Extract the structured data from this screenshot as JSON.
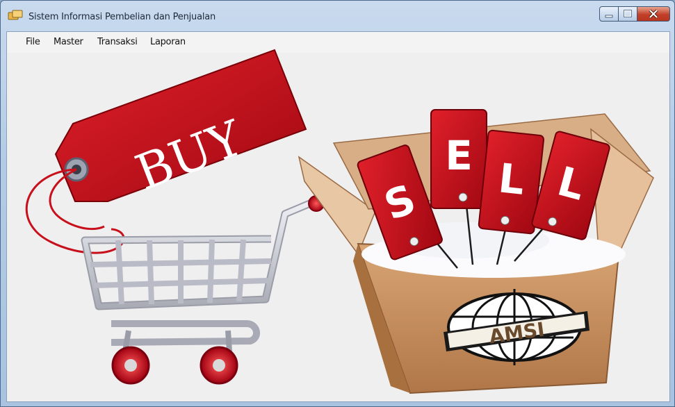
{
  "window": {
    "title": "Sistem Informasi Pembelian dan Penjualan"
  },
  "menubar": {
    "items": [
      {
        "label": "File"
      },
      {
        "label": "Master"
      },
      {
        "label": "Transaksi"
      },
      {
        "label": "Laporan"
      }
    ]
  },
  "artwork": {
    "buy_tag_text": "BUY",
    "sell_letters": [
      "S",
      "E",
      "L",
      "L"
    ],
    "box_logo_text": "AMSI"
  },
  "colors": {
    "tag_red": "#c4101c",
    "cart_silver": "#c9c9cf",
    "box_brown": "#c8956a",
    "client_bg": "#efefef"
  }
}
